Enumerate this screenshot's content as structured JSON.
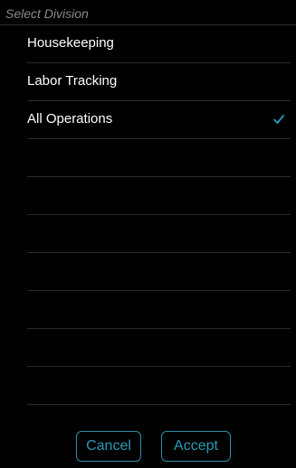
{
  "picker": {
    "title": "Select Division",
    "options": [
      {
        "label": "Housekeeping",
        "selected": false
      },
      {
        "label": "Labor Tracking",
        "selected": false
      },
      {
        "label": "All Operations",
        "selected": true
      }
    ]
  },
  "footer": {
    "cancel_label": "Cancel",
    "accept_label": "Accept"
  },
  "colors": {
    "background": "#000000",
    "accent": "#2a9bb8",
    "divider": "#2b2b2b",
    "placeholder": "#8a8a8a"
  },
  "icons": {
    "selected_marker": "checkmark-icon"
  }
}
